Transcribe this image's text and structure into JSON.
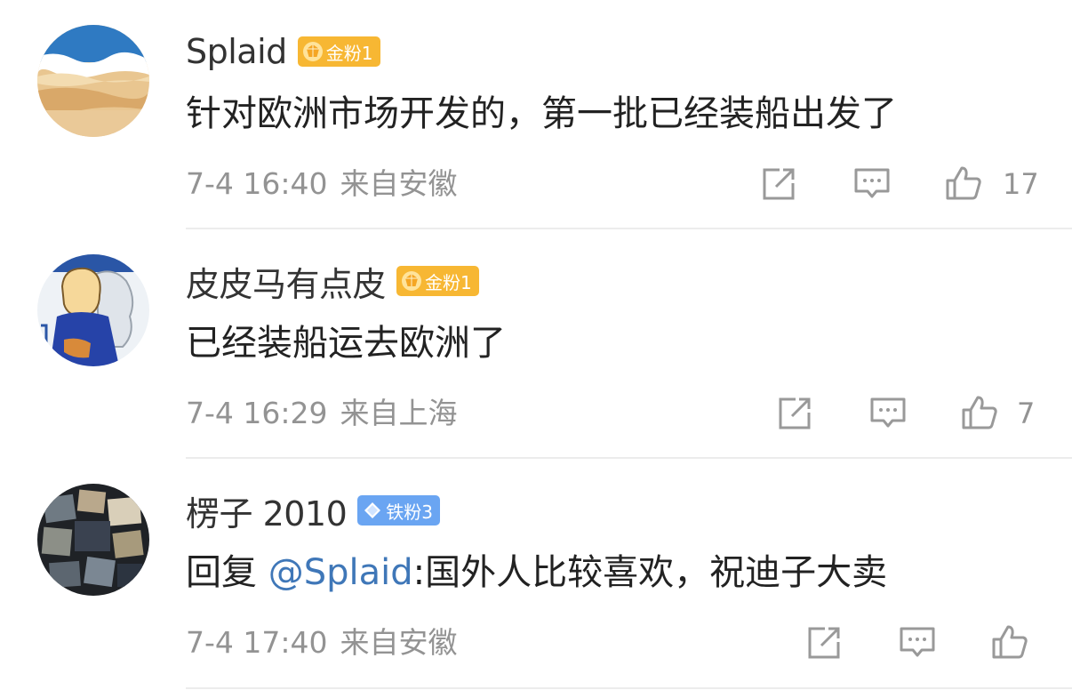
{
  "comments": [
    {
      "username": "Splaid",
      "badge": "金粉1",
      "badge_type": "gold",
      "text": "针对欧洲市场开发的，第一批已经装船出发了",
      "time": "7-4 16:40",
      "location": "来自安徽",
      "likes": "17",
      "avatar_icon": "beach-avatar"
    },
    {
      "username": "皮皮马有点皮",
      "badge": "金粉1",
      "badge_type": "gold",
      "text": "已经装船运去欧洲了",
      "time": "7-4 16:29",
      "location": "来自上海",
      "likes": "7",
      "avatar_icon": "cartoon-avatar"
    },
    {
      "username": "楞子 2010",
      "badge": "铁粉3",
      "badge_type": "iron",
      "reply_prefix": "回复 ",
      "mention": "@Splaid",
      "text": ":国外人比较喜欢，祝迪子大卖",
      "time": "7-4 17:40",
      "location": "来自安徽",
      "likes": "",
      "avatar_icon": "collage-avatar"
    }
  ],
  "colors": {
    "gold_badge": "#f7b733",
    "iron_badge": "#6aa5f2",
    "mention": "#3f77b8",
    "meta_text": "#939393"
  }
}
